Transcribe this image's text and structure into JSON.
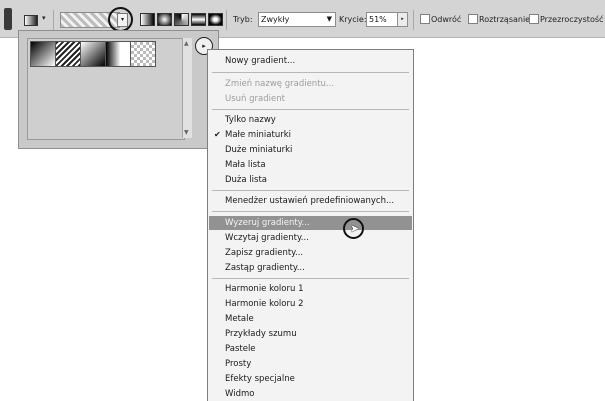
{
  "options_bar": {
    "mode_label": "Tryb:",
    "mode_value": "Zwykły",
    "opacity_label": "Krycie:",
    "opacity_value": "51%",
    "checkboxes": [
      "Odwróć",
      "Roztrząsanie",
      "Przezroczystość"
    ]
  },
  "menu": {
    "items": [
      {
        "label": "Nowy gradient...",
        "state": "normal"
      },
      {
        "label": "Zmień nazwę gradientu...",
        "state": "disabled"
      },
      {
        "label": "Usuń gradient",
        "state": "disabled"
      },
      {
        "label": "Tylko nazwy",
        "state": "normal"
      },
      {
        "label": "Małe miniaturki",
        "state": "checked"
      },
      {
        "label": "Duże miniaturki",
        "state": "normal"
      },
      {
        "label": "Mała lista",
        "state": "normal"
      },
      {
        "label": "Duża lista",
        "state": "normal"
      },
      {
        "label": "Menedżer ustawień predefiniowanych...",
        "state": "normal"
      },
      {
        "label": "Wyzeruj gradienty...",
        "state": "highlighted"
      },
      {
        "label": "Wczytaj gradienty...",
        "state": "normal"
      },
      {
        "label": "Zapisz gradienty...",
        "state": "normal"
      },
      {
        "label": "Zastąp gradienty...",
        "state": "normal"
      },
      {
        "label": "Harmonie koloru 1",
        "state": "normal"
      },
      {
        "label": "Harmonie koloru 2",
        "state": "normal"
      },
      {
        "label": "Metale",
        "state": "normal"
      },
      {
        "label": "Przykłady szumu",
        "state": "normal"
      },
      {
        "label": "Pastele",
        "state": "normal"
      },
      {
        "label": "Prosty",
        "state": "normal"
      },
      {
        "label": "Efekty specjalne",
        "state": "normal"
      },
      {
        "label": "Widmo",
        "state": "normal"
      }
    ]
  },
  "colors": {
    "menu_highlight": "#929292",
    "toolbar_bg": "#d4d4d4"
  }
}
